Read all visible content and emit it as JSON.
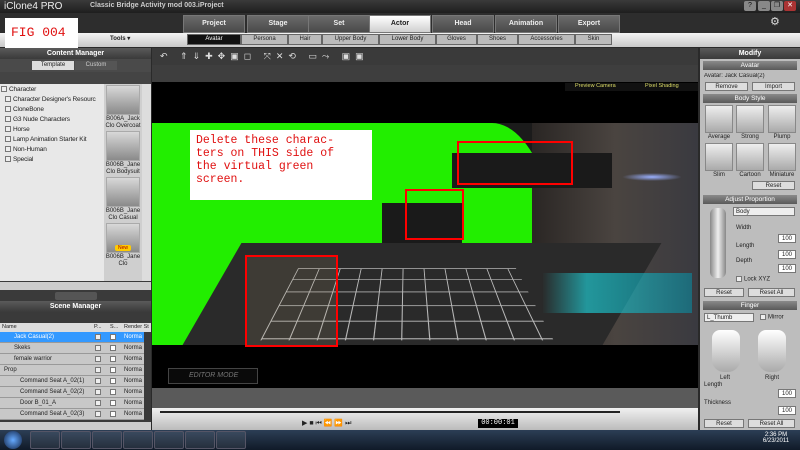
{
  "app": {
    "title": "iClone4 PRO",
    "project": "Classic Bridge Activity mod 003.iProject",
    "window_buttons": [
      "?",
      "_",
      "❐",
      "✕"
    ]
  },
  "fig_label": "FIG 004",
  "main_tabs": [
    "Project",
    "Stage",
    "Set",
    "Actor",
    "Head",
    "Animation",
    "Export"
  ],
  "tools_label": "Tools ▾",
  "sub_tabs": [
    "Avatar",
    "Persona",
    "Hair",
    "Upper Body",
    "Lower Body",
    "Gloves",
    "Shoes",
    "Accessories",
    "Skin"
  ],
  "content_manager": {
    "title": "Content Manager",
    "tabs": [
      "Template",
      "Custom"
    ],
    "tree": [
      "Character",
      "Character Designer's Resourc",
      "CloneBone",
      "G3 Nude Characters",
      "Horse",
      "Lamp Animation Starter Kit",
      "Non-Human",
      "Special"
    ],
    "thumbnails": [
      "B006A_Jack Clo Overcoat",
      "B006B_Jane Clo Bodysuit",
      "B006B_Jane Clo Casual",
      "B006B_Jane Clo"
    ],
    "new_badge": "New"
  },
  "scene_manager": {
    "title": "Scene Manager",
    "columns": [
      "Name",
      "P...",
      "S...",
      "Render St"
    ],
    "rows": [
      {
        "name": "Jack Casual(2)",
        "render": "Norma",
        "sel": true
      },
      {
        "name": "Skeks",
        "render": "Norma"
      },
      {
        "name": "female warrior",
        "render": "Norma"
      },
      {
        "name": "Prop",
        "render": "Norma"
      },
      {
        "name": "Command Seat A_02(1)",
        "render": "Norma"
      },
      {
        "name": "Command Seat A_02(2)",
        "render": "Norma"
      },
      {
        "name": "Door B_01_A",
        "render": "Norma"
      },
      {
        "name": "Command Seat A_02(3)",
        "render": "Norma"
      }
    ]
  },
  "viewport": {
    "preview_camera": "Preview Camera",
    "pixel_shading": "Pixel Shading",
    "editor_mode": "EDITOR MODE",
    "annotation": "Delete these charac-\nters on THIS side of\nthe virtual green\nscreen.",
    "timecode": "00:00:01"
  },
  "modify": {
    "title": "Modify",
    "avatar_bar": "Avatar",
    "avatar_name": "Avatar: Jack Casual(2)",
    "remove": "Remove",
    "import": "Import",
    "body_style": "Body Style",
    "styles": [
      "Average",
      "Strong",
      "Plump",
      "Slim",
      "Cartoon",
      "Miniature"
    ],
    "reset": "Reset",
    "adjust_proportion": "Adjust Proportion",
    "part": "Body",
    "width_label": "Width",
    "length_label": "Length",
    "depth_label": "Depth",
    "width": "100",
    "length": "100",
    "depth": "100",
    "lock_xyz": "Lock XYZ",
    "reset_all": "Reset All",
    "finger": "Finger",
    "finger_select": "L_Thumb",
    "mirror": "Mirror",
    "left": "Left",
    "right": "Right",
    "f_length_label": "Length",
    "f_length": "100",
    "thickness_label": "Thickness",
    "thickness": "100"
  },
  "taskbar": {
    "time": "2:36 PM",
    "date": "6/23/2011"
  }
}
